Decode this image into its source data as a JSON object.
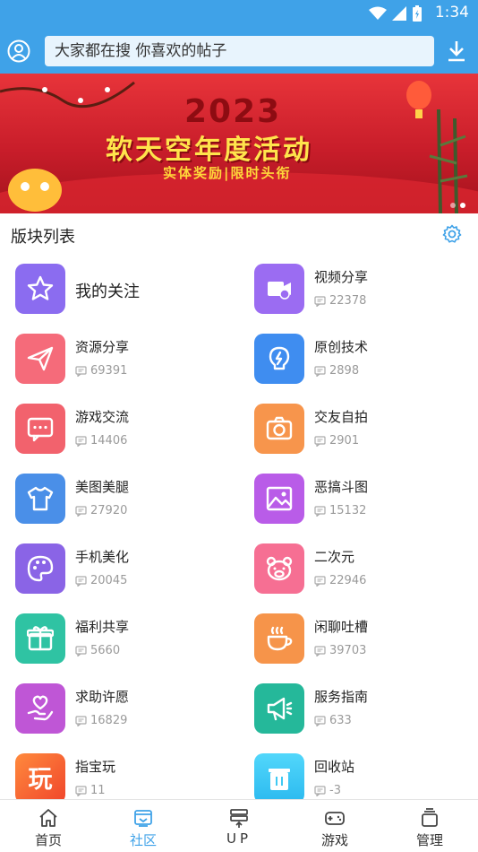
{
  "status_bar": {
    "time": "1:34"
  },
  "header": {
    "search_placeholder": "大家都在搜  你喜欢的帖子"
  },
  "banner": {
    "year": "2023",
    "title": "软天空年度活动",
    "subtitle": "实体奖励|限时头衔"
  },
  "section": {
    "title": "版块列表"
  },
  "forums": [
    {
      "name": "我的关注",
      "count": "",
      "icon": "star-icon",
      "color": "#8b6cf0"
    },
    {
      "name": "视频分享",
      "count": "22378",
      "icon": "video-icon",
      "color": "#9b6cf2"
    },
    {
      "name": "资源分享",
      "count": "69391",
      "icon": "send-icon",
      "color": "#f56b7a"
    },
    {
      "name": "原创技术",
      "count": "2898",
      "icon": "bulb-icon",
      "color": "#3f8df0"
    },
    {
      "name": "游戏交流",
      "count": "14406",
      "icon": "chat-icon",
      "color": "#f2626d"
    },
    {
      "name": "交友自拍",
      "count": "2901",
      "icon": "camera-icon",
      "color": "#f7954c"
    },
    {
      "name": "美图美腿",
      "count": "27920",
      "icon": "shirt-icon",
      "color": "#4a8fe8"
    },
    {
      "name": "恶搞斗图",
      "count": "15132",
      "icon": "image-icon",
      "color": "#b95ce8"
    },
    {
      "name": "手机美化",
      "count": "20045",
      "icon": "palette-icon",
      "color": "#8a64e6"
    },
    {
      "name": "二次元",
      "count": "22946",
      "icon": "bear-icon",
      "color": "#f66f93"
    },
    {
      "name": "福利共享",
      "count": "5660",
      "icon": "gift-icon",
      "color": "#2fc3a3"
    },
    {
      "name": "闲聊吐槽",
      "count": "39703",
      "icon": "cup-icon",
      "color": "#f6944a"
    },
    {
      "name": "求助许愿",
      "count": "16829",
      "icon": "heart-hand-icon",
      "color": "#bf56d6"
    },
    {
      "name": "服务指南",
      "count": "633",
      "icon": "megaphone-icon",
      "color": "#25b89a"
    },
    {
      "name": "指宝玩",
      "count": "11",
      "icon": "play-text-icon",
      "color": "#f3562f",
      "glyph": "玩"
    },
    {
      "name": "回收站",
      "count": "-3",
      "icon": "trash-icon",
      "color": "#3fc9f3"
    }
  ],
  "nav": [
    {
      "label": "首页",
      "icon": "home-icon"
    },
    {
      "label": "社区",
      "icon": "community-icon",
      "active": true
    },
    {
      "label": "UP",
      "icon": "upload-icon"
    },
    {
      "label": "游戏",
      "icon": "gamepad-icon"
    },
    {
      "label": "管理",
      "icon": "manage-icon"
    }
  ],
  "colors": {
    "primary": "#3fa2e8",
    "search_bg": "#e8f4fd"
  }
}
